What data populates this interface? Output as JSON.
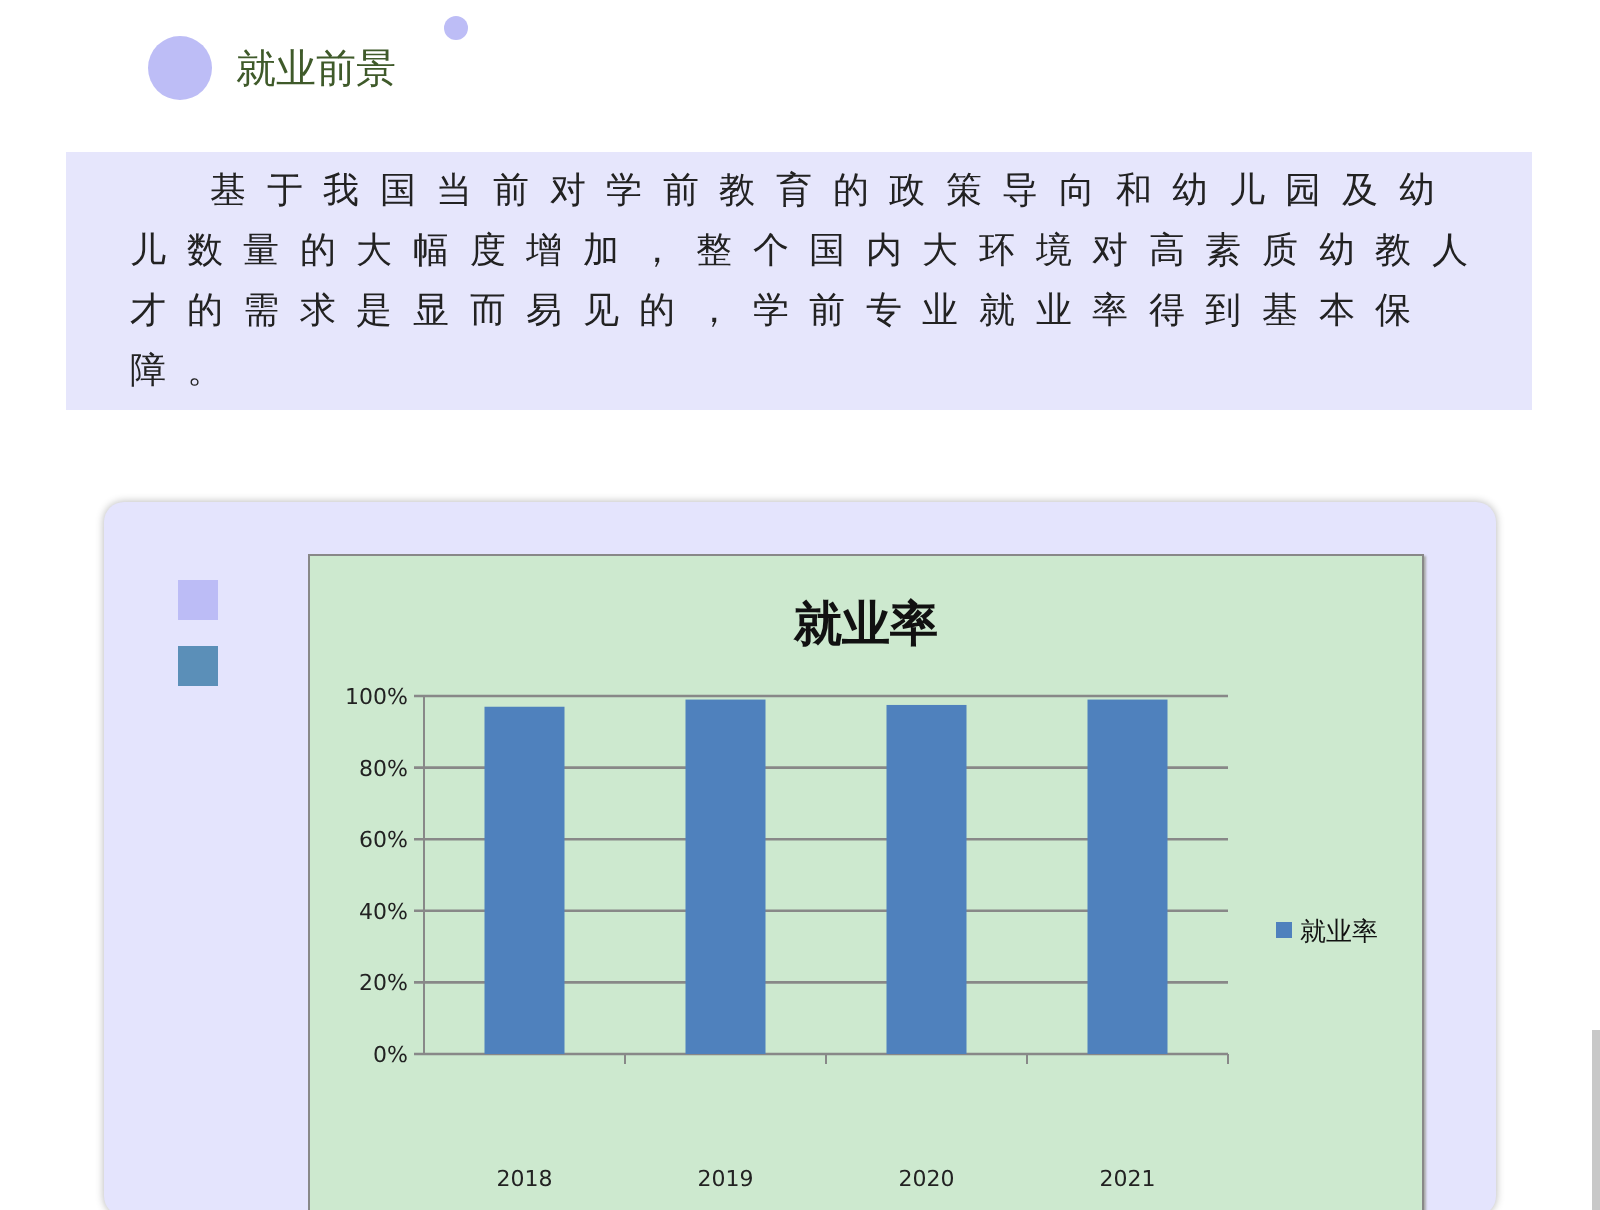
{
  "section": {
    "title": "就业前景"
  },
  "paragraph": "基于我国当前对学前教育的政策导向和幼儿园及幼儿数量的大幅度增加，整个国内大环境对高素质幼教人才的需求是显而易见的，学前专业就业率得到基本保障。",
  "card": {
    "chart_data": {
      "type": "bar",
      "title": "就业率",
      "categories": [
        "2018",
        "2019",
        "2020",
        "2021"
      ],
      "series": [
        {
          "name": "就业率",
          "color": "#4f81bd",
          "values": [
            0.97,
            0.99,
            0.975,
            0.99
          ]
        }
      ],
      "ylim": [
        0,
        1
      ],
      "grid": true,
      "yticks": [
        {
          "value": 0,
          "label": "0%"
        },
        {
          "value": 0.2,
          "label": "20%"
        },
        {
          "value": 0.4,
          "label": "40%"
        },
        {
          "value": 0.6,
          "label": "60%"
        },
        {
          "value": 0.8,
          "label": "80%"
        },
        {
          "value": 1,
          "label": "100%"
        }
      ]
    }
  }
}
